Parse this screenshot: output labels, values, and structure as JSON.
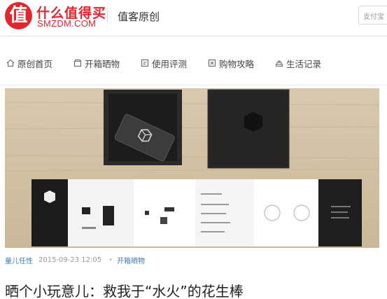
{
  "header": {
    "logo_glyph": "值",
    "logo_cn": "什么值得买",
    "logo_en": "SMZDM.COM",
    "section_title": "值客原创",
    "search_placeholder": "支付宝"
  },
  "nav": {
    "items": [
      {
        "label": "原创首页",
        "icon": "home-icon"
      },
      {
        "label": "开箱晒物",
        "icon": "box-icon"
      },
      {
        "label": "使用评测",
        "icon": "review-icon"
      },
      {
        "label": "购物攻略",
        "icon": "guide-icon"
      },
      {
        "label": "生活记录",
        "icon": "life-icon"
      }
    ]
  },
  "article": {
    "author": "童儿任性",
    "date": "2015-09-23 12:05",
    "category_separator": "•",
    "category": "开箱晒物",
    "title": "晒个小玩意儿：救我于“水火”的花生棒"
  },
  "colors": {
    "brand": "#e3262d",
    "link": "#4a7ab5"
  }
}
